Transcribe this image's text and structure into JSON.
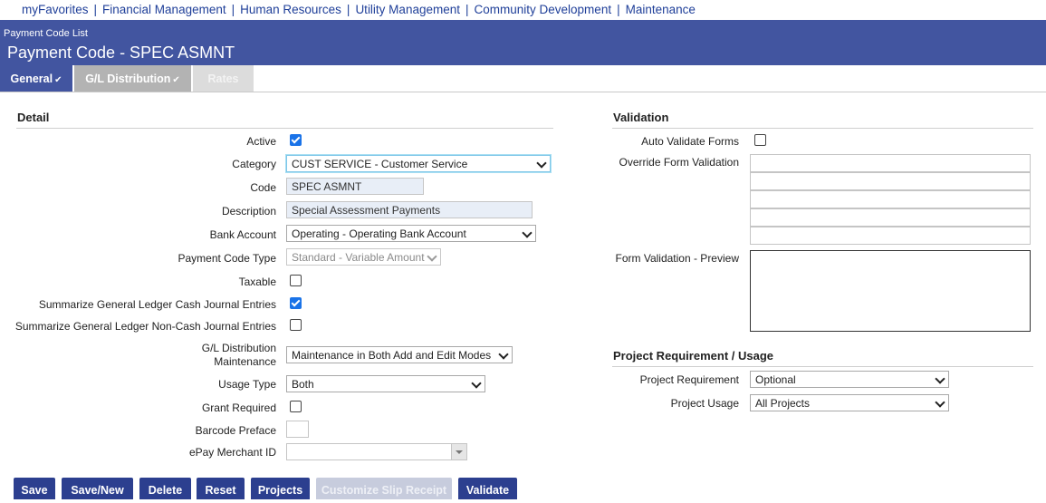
{
  "topnav": {
    "items": [
      "myFavorites",
      "Financial Management",
      "Human Resources",
      "Utility Management",
      "Community Development",
      "Maintenance"
    ]
  },
  "header": {
    "breadcrumb": "Payment Code List",
    "title": "Payment Code - SPEC ASMNT"
  },
  "tabs": [
    {
      "label": "General",
      "checked": "✔"
    },
    {
      "label": "G/L Distribution",
      "checked": "✔"
    },
    {
      "label": "Rates"
    }
  ],
  "detail": {
    "title": "Detail",
    "active_label": "Active",
    "category_label": "Category",
    "category_value": "CUST SERVICE - Customer Service",
    "code_label": "Code",
    "code_value": "SPEC ASMNT",
    "description_label": "Description",
    "description_value": "Special Assessment Payments",
    "bank_account_label": "Bank Account",
    "bank_account_value": "Operating - Operating Bank Account",
    "payment_code_type_label": "Payment Code Type",
    "payment_code_type_value": "Standard - Variable Amount",
    "taxable_label": "Taxable",
    "summarize_cash_label": "Summarize General Ledger Cash Journal Entries",
    "summarize_noncash_label": "Summarize General Ledger Non-Cash Journal Entries",
    "gl_maint_label_1": "G/L Distribution",
    "gl_maint_label_2": "Maintenance",
    "gl_maint_value": "Maintenance in Both Add and Edit Modes",
    "usage_type_label": "Usage Type",
    "usage_type_value": "Both",
    "grant_required_label": "Grant Required",
    "barcode_preface_label": "Barcode Preface",
    "epay_label": "ePay Merchant ID"
  },
  "validation": {
    "title": "Validation",
    "auto_validate_label": "Auto Validate Forms",
    "override_label": "Override Form Validation",
    "preview_label": "Form Validation - Preview"
  },
  "project": {
    "title": "Project Requirement / Usage",
    "requirement_label": "Project Requirement",
    "requirement_value": "Optional",
    "usage_label": "Project Usage",
    "usage_value": "All Projects"
  },
  "buttons": {
    "save": "Save",
    "save_new": "Save/New",
    "delete": "Delete",
    "reset": "Reset",
    "projects": "Projects",
    "customize": "Customize Slip Receipt",
    "validate": "Validate"
  },
  "colors": {
    "header_bg": "#4255a0",
    "link": "#1f3f99",
    "button_bg": "#2c3f8f",
    "checkbox_checked": "#1a73e8"
  }
}
